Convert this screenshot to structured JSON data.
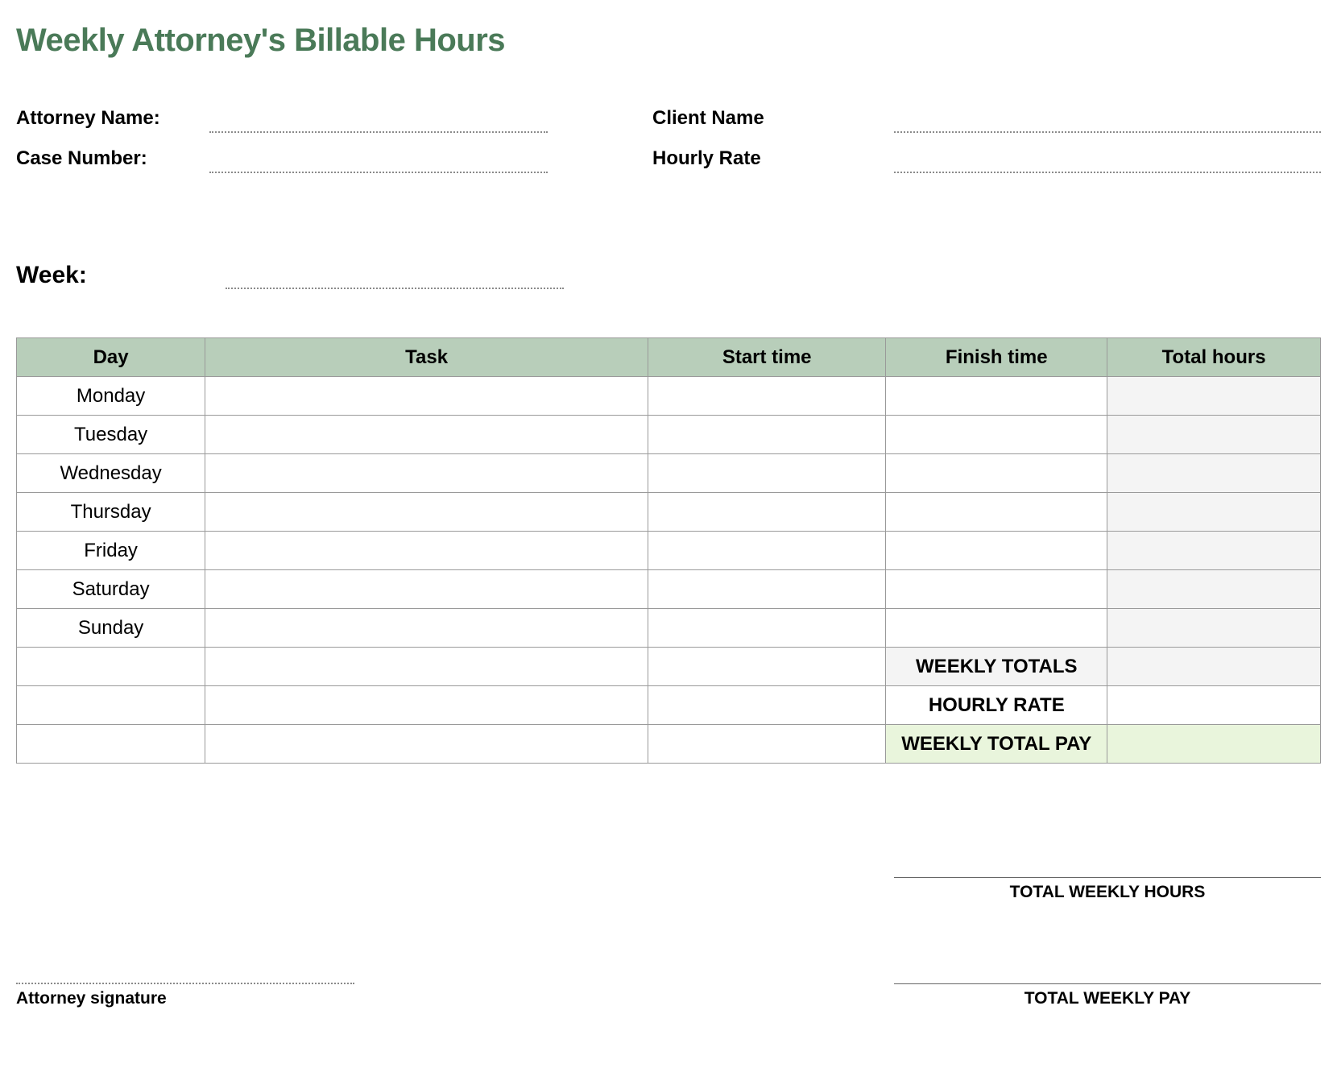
{
  "title": "Weekly Attorney's Billable Hours",
  "info": {
    "attorney_name_label": "Attorney Name:",
    "attorney_name_value": "",
    "case_number_label": "Case Number:",
    "case_number_value": "",
    "client_name_label": "Client Name",
    "client_name_value": "",
    "hourly_rate_label": "Hourly Rate",
    "hourly_rate_value": ""
  },
  "week": {
    "label": "Week:",
    "value": ""
  },
  "table": {
    "headers": {
      "day": "Day",
      "task": "Task",
      "start": "Start time",
      "finish": "Finish time",
      "total": "Total hours"
    },
    "rows": [
      {
        "day": "Monday",
        "task": "",
        "start": "",
        "finish": "",
        "total": ""
      },
      {
        "day": "Tuesday",
        "task": "",
        "start": "",
        "finish": "",
        "total": ""
      },
      {
        "day": "Wednesday",
        "task": "",
        "start": "",
        "finish": "",
        "total": ""
      },
      {
        "day": "Thursday",
        "task": "",
        "start": "",
        "finish": "",
        "total": ""
      },
      {
        "day": "Friday",
        "task": "",
        "start": "",
        "finish": "",
        "total": ""
      },
      {
        "day": "Saturday",
        "task": "",
        "start": "",
        "finish": "",
        "total": ""
      },
      {
        "day": "Sunday",
        "task": "",
        "start": "",
        "finish": "",
        "total": ""
      }
    ],
    "summary": {
      "weekly_totals_label": "WEEKLY TOTALS",
      "weekly_totals_value": "",
      "hourly_rate_label": "HOURLY RATE",
      "hourly_rate_value": "",
      "weekly_total_pay_label": "WEEKLY TOTAL PAY",
      "weekly_total_pay_value": ""
    }
  },
  "footer": {
    "signature_label": "Attorney signature",
    "total_weekly_hours_label": "TOTAL WEEKLY HOURS",
    "total_weekly_hours_value": "",
    "total_weekly_pay_label": "TOTAL WEEKLY PAY",
    "total_weekly_pay_value": ""
  }
}
